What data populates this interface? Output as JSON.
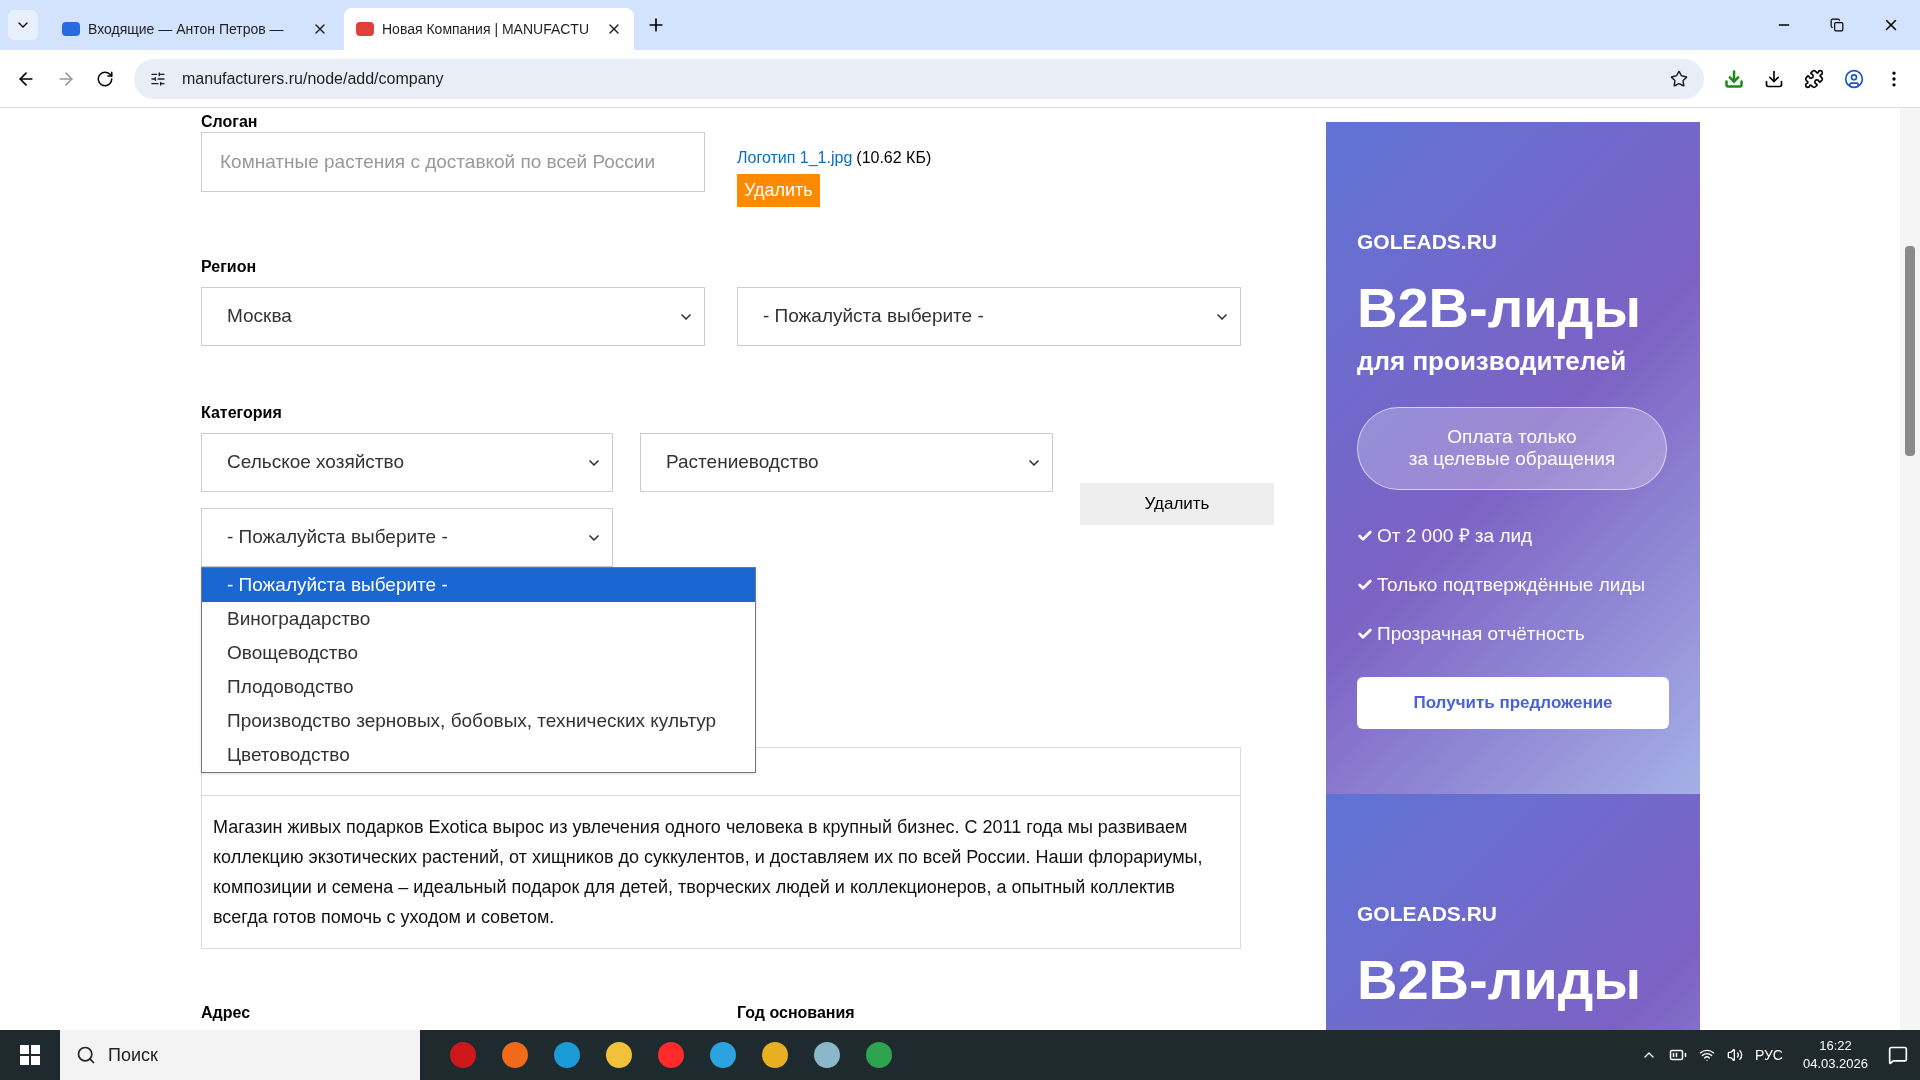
{
  "browser": {
    "tabs": [
      {
        "title": "Входящие — Антон Петров —",
        "selected": false
      },
      {
        "title": "Новая Компания | MANUFACTU",
        "selected": true
      }
    ],
    "url": "manufacturers.ru/node/add/company"
  },
  "form": {
    "slogan": {
      "label": "Слоган",
      "placeholder": "Комнатные растения с доставкой по всей России"
    },
    "logo": {
      "file_link": "Логотип 1_1.jpg",
      "size": "(10.62 КБ)",
      "delete_label": "Удалить"
    },
    "region": {
      "label": "Регион",
      "selects": [
        {
          "value": "Москва"
        },
        {
          "value": "- Пожалуйста выберите -"
        }
      ]
    },
    "category": {
      "label": "Категория",
      "selects": [
        {
          "value": "Сельское хозяйство"
        },
        {
          "value": "Растениеводство"
        }
      ],
      "delete_label": "Удалить",
      "open_select": {
        "value": "- Пожалуйста выберите -",
        "options": [
          {
            "label": "- Пожалуйста выберите -",
            "selected": true
          },
          {
            "label": "Виноградарство",
            "selected": false
          },
          {
            "label": "Овощеводство",
            "selected": false
          },
          {
            "label": "Плодоводство",
            "selected": false
          },
          {
            "label": "Производство зерновых, бобовых, технических культур",
            "selected": false
          },
          {
            "label": "Цветоводство",
            "selected": false
          }
        ]
      }
    },
    "editor": {
      "text": "Магазин живых подарков Exotica вырос из увлечения одного человека в крупный бизнес. С 2011 года мы развиваем коллекцию экзотических растений, от хищников до суккулентов, и доставляем их по всей России. Наши флорариумы, композиции и семена – идеальный подарок для детей, творческих людей и коллекционеров, а опытный коллектив всегда готов помочь с уходом и советом."
    },
    "address_label": "Адрес",
    "year_label": "Год основания"
  },
  "ads": [
    {
      "brand": "GOLEADS.RU",
      "headline": "B2B-лиды",
      "subheadline": "для производителей",
      "pill": "Оплата только\nза целевые обращения",
      "points": [
        "От 2 000 ₽ за лид",
        "Только подтверждённые лиды",
        "Прозрачная отчётность"
      ],
      "cta": "Получить предложение"
    },
    {
      "brand": "GOLEADS.RU",
      "headline": "B2B-лиды"
    }
  ],
  "taskbar": {
    "search_placeholder": "Поиск",
    "language": "РУС",
    "time": "16:22",
    "date": "04.03.2026"
  }
}
